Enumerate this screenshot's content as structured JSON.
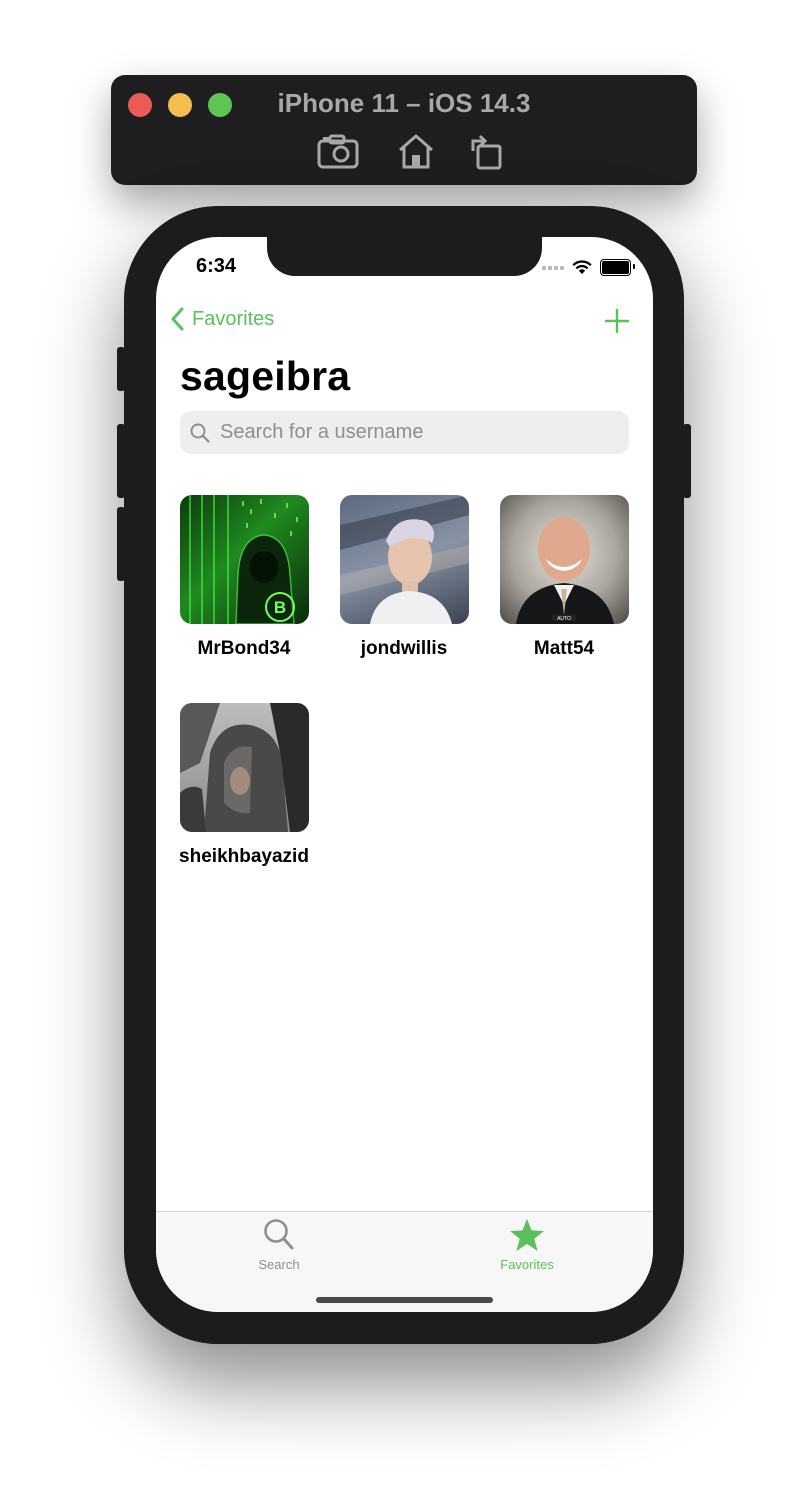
{
  "simulator": {
    "title": "iPhone 11 – iOS 14.3",
    "tools": [
      "camera-icon",
      "home-icon",
      "rotate-icon"
    ]
  },
  "status_bar": {
    "time": "6:34"
  },
  "nav": {
    "back_label": "Favorites",
    "title": "sageibra",
    "add_icon": "plus-icon"
  },
  "search": {
    "placeholder": "Search for a username",
    "value": ""
  },
  "followers": [
    {
      "username": "MrBond34"
    },
    {
      "username": "jondwillis"
    },
    {
      "username": "Matt54"
    },
    {
      "username": "sheikhbayazid"
    }
  ],
  "tabbar": {
    "tabs": [
      {
        "label": "Search",
        "icon": "search-icon",
        "selected": false
      },
      {
        "label": "Favorites",
        "icon": "star-icon",
        "selected": true
      }
    ]
  },
  "colors": {
    "accent": "#5ac05e",
    "inactive": "#8e8e93"
  }
}
